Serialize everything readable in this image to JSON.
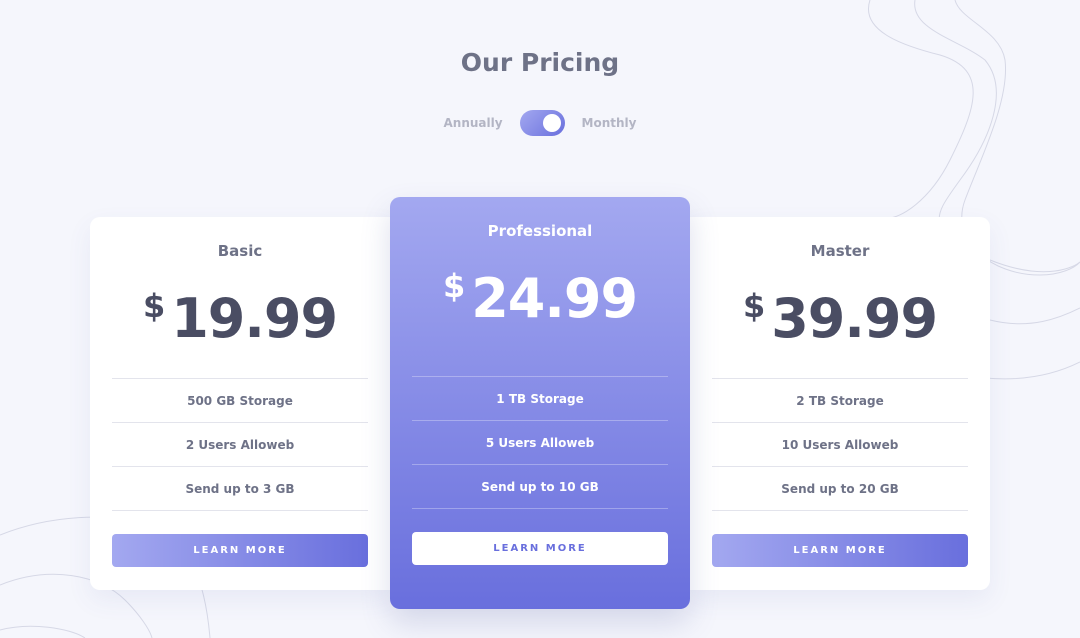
{
  "header": {
    "title": "Our Pricing"
  },
  "billing_toggle": {
    "left_label": "Annually",
    "right_label": "Monthly",
    "selected": "Monthly"
  },
  "plans": [
    {
      "name": "Basic",
      "currency": "$",
      "price": "19.99",
      "features": [
        "500 GB Storage",
        "2 Users Alloweb",
        "Send up to 3 GB"
      ],
      "button_label": "LEARN MORE"
    },
    {
      "name": "Professional",
      "currency": "$",
      "price": "24.99",
      "features": [
        "1 TB Storage",
        "5 Users Alloweb",
        "Send up to 10 GB"
      ],
      "button_label": "LEARN MORE"
    },
    {
      "name": "Master",
      "currency": "$",
      "price": "39.99",
      "features": [
        "2 TB Storage",
        "10 Users Alloweb",
        "Send up to 20 GB"
      ],
      "button_label": "LEARN MORE"
    }
  ],
  "colors": {
    "background": "#f5f6fc",
    "gradient_start": "#a3a8f0",
    "gradient_end": "#696fdd",
    "heading_text": "#6e7287",
    "price_text": "#4a4d63"
  }
}
